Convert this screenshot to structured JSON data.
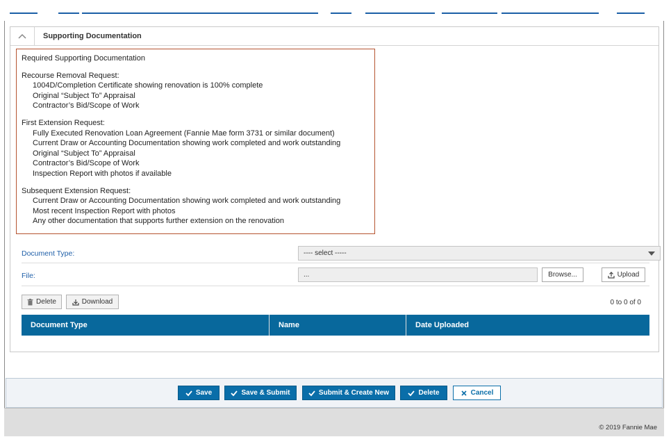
{
  "panel": {
    "title": "Supporting Documentation"
  },
  "requirements": {
    "heading": "Required Supporting Documentation",
    "sections": [
      {
        "title": "Recourse Removal Request:",
        "items": [
          "1004D/Completion Certificate showing renovation is 100% complete",
          "Original “Subject To” Appraisal",
          "Contractor’s Bid/Scope of Work"
        ]
      },
      {
        "title": "First Extension Request:",
        "items": [
          "Fully Executed Renovation Loan Agreement (Fannie Mae form 3731 or similar document)",
          "Current Draw or Accounting Documentation showing work completed and work outstanding",
          "Original “Subject To” Appraisal",
          "Contractor’s Bid/Scope of Work",
          "Inspection Report with photos if available"
        ]
      },
      {
        "title": "Subsequent Extension Request:",
        "items": [
          "Current Draw or Accounting Documentation showing work completed and work outstanding",
          "Most recent Inspection Report with photos",
          "Any other documentation that supports further extension on the renovation"
        ]
      }
    ]
  },
  "form": {
    "document_type_label": "Document Type:",
    "document_type_value": "---- select -----",
    "file_label": "File:",
    "file_value": "...",
    "browse_label": "Browse...",
    "upload_label": "Upload"
  },
  "grid": {
    "delete_label": "Delete",
    "download_label": "Download",
    "count_text": "0 to 0 of 0",
    "columns": [
      "Document Type",
      "Name",
      "Date Uploaded"
    ]
  },
  "actions": {
    "save": "Save",
    "save_submit": "Save & Submit",
    "submit_create": "Submit & Create New",
    "delete": "Delete",
    "cancel": "Cancel"
  },
  "footer": {
    "copyright": "© 2019 Fannie Mae"
  },
  "colors": {
    "primary": "#0a6ea9",
    "table_header": "#08689c",
    "label_blue": "#1f5fa8",
    "box_border": "#b5532f"
  }
}
